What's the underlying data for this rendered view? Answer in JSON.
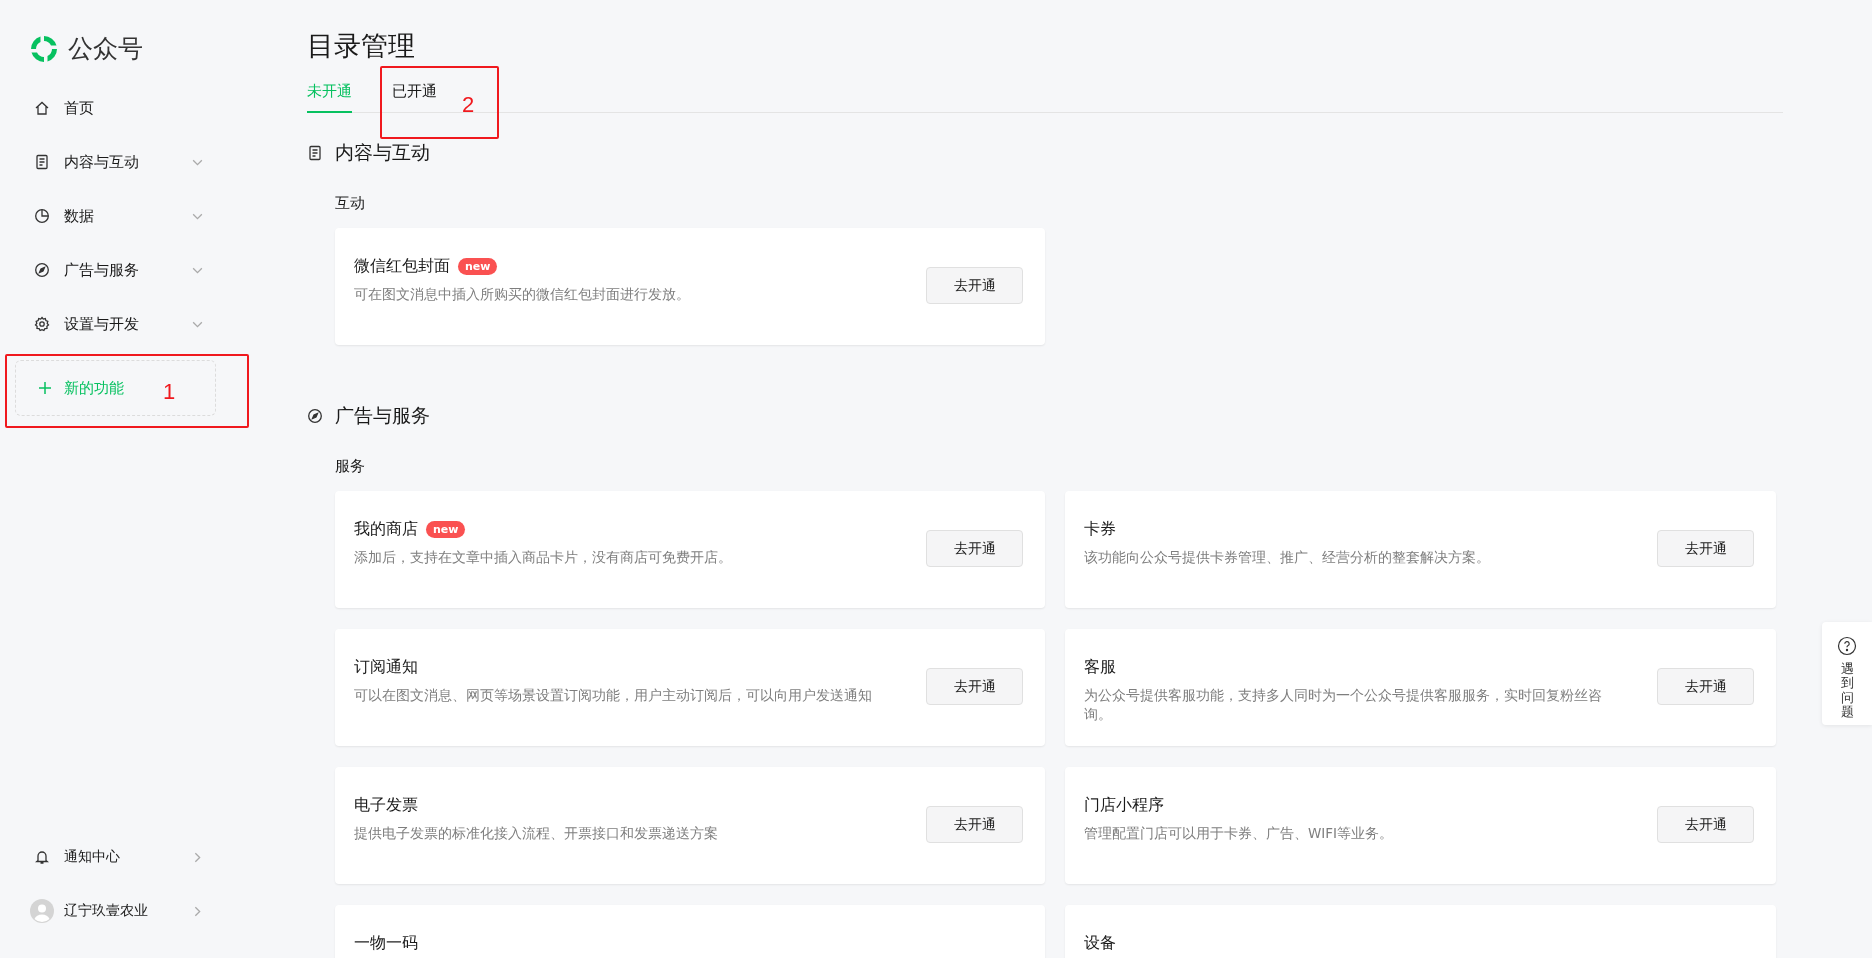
{
  "app": {
    "name": "公众号"
  },
  "sidebar": {
    "items": [
      {
        "label": "首页",
        "kind": "link"
      },
      {
        "label": "内容与互动",
        "kind": "group",
        "expanded": false
      },
      {
        "label": "数据",
        "kind": "group",
        "expanded": false
      },
      {
        "label": "广告与服务",
        "kind": "group",
        "expanded": false
      },
      {
        "label": "设置与开发",
        "kind": "group",
        "expanded": false
      }
    ],
    "new_feature": {
      "label": "新的功能"
    },
    "footer": [
      {
        "label": "通知中心",
        "kind": "notifications"
      },
      {
        "label": "辽宁玖壹农业",
        "kind": "account"
      }
    ]
  },
  "page": {
    "title": "目录管理"
  },
  "tabs": [
    {
      "label": "未开通",
      "selected": true
    },
    {
      "label": "已开通",
      "selected": false
    }
  ],
  "sections": [
    {
      "title": "内容与互动",
      "groups": [
        {
          "title": "互动",
          "cards": [
            {
              "title": "微信红包封面",
              "badge": "new",
              "description": "可在图文消息中插入所购买的微信红包封面进行发放。",
              "button": "去开通"
            }
          ]
        }
      ]
    },
    {
      "title": "广告与服务",
      "groups": [
        {
          "title": "服务",
          "cards": [
            {
              "title": "我的商店",
              "badge": "new",
              "description": "添加后，支持在文章中插入商品卡片，没有商店可免费开店。",
              "button": "去开通"
            },
            {
              "title": "卡券",
              "description": "该功能向公众号提供卡券管理、推广、经营分析的整套解决方案。",
              "button": "去开通"
            },
            {
              "title": "订阅通知",
              "description": "可以在图文消息、网页等场景设置订阅功能，用户主动订阅后，可以向用户发送通知",
              "button": "去开通"
            },
            {
              "title": "客服",
              "description": "为公众号提供客服功能，支持多人同时为一个公众号提供客服服务，实时回复粉丝咨询。",
              "button": "去开通"
            },
            {
              "title": "电子发票",
              "description": "提供电子发票的标准化接入流程、开票接口和发票递送方案",
              "button": "去开通"
            },
            {
              "title": "门店小程序",
              "description": "管理配置门店可以用于卡券、广告、WIFI等业务。",
              "button": "去开通"
            },
            {
              "title": "一物一码"
            },
            {
              "title": "设备"
            }
          ]
        }
      ]
    }
  ],
  "help": {
    "label": "遇到问题"
  },
  "annotations": [
    {
      "label": "1"
    },
    {
      "label": "2"
    }
  ]
}
